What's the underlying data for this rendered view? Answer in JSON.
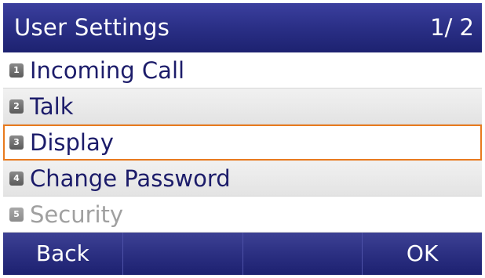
{
  "header": {
    "title": "User Settings",
    "page_indicator": "1/ 2"
  },
  "menu": {
    "items": [
      {
        "number": "1",
        "label": "Incoming Call"
      },
      {
        "number": "2",
        "label": "Talk"
      },
      {
        "number": "3",
        "label": "Display"
      },
      {
        "number": "4",
        "label": "Change Password"
      },
      {
        "number": "5",
        "label": "Security"
      }
    ],
    "selected_index": 2
  },
  "softkeys": {
    "key1": "Back",
    "key2": "",
    "key3": "",
    "key4": "OK"
  },
  "colors": {
    "header_bg": "#2a2f86",
    "highlight": "#e87a1e",
    "text": "#1c1c6a",
    "disabled_text": "#a0a0a0"
  }
}
